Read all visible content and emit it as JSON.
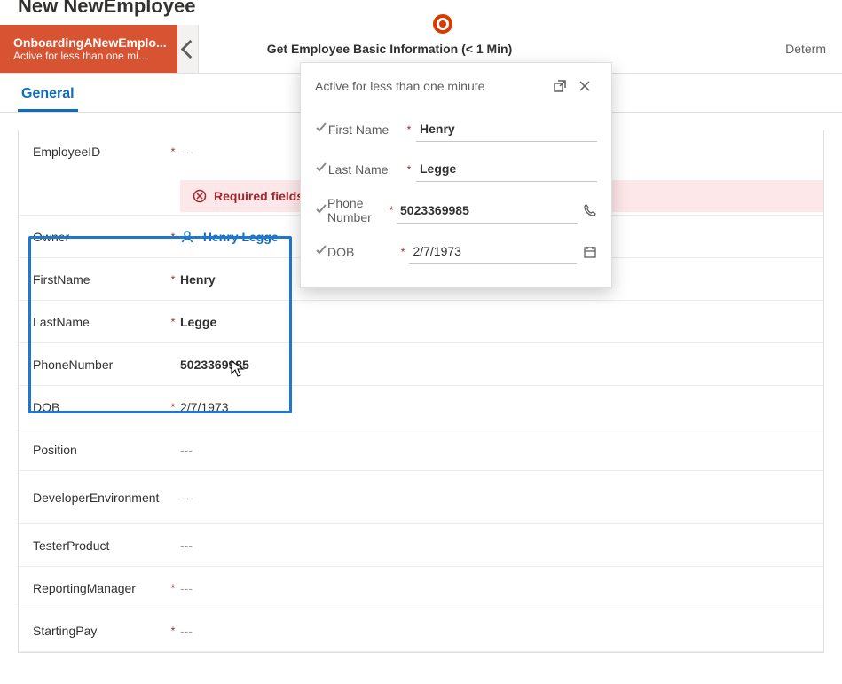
{
  "header": {
    "title": "New NewEmployee"
  },
  "bpf": {
    "active": {
      "name": "OnboardingANewEmplo...",
      "sub": "Active for less than one mi..."
    },
    "current": "Get Employee Basic Information  (< 1 Min)",
    "next": "Determ"
  },
  "tabs": {
    "general": "General"
  },
  "form": {
    "employeeId": {
      "label": "EmployeeID",
      "value": "---"
    },
    "errorBanner": "Required fields",
    "owner": {
      "label": "Owner",
      "value": "Henry Legge"
    },
    "firstName": {
      "label": "FirstName",
      "value": "Henry"
    },
    "lastName": {
      "label": "LastName",
      "value": "Legge"
    },
    "phone": {
      "label": "PhoneNumber",
      "value": "5023369985"
    },
    "dob": {
      "label": "DOB",
      "value": "2/7/1973"
    },
    "position": {
      "label": "Position",
      "value": "---"
    },
    "devEnv": {
      "label": "DeveloperEnvironment",
      "value": "---"
    },
    "testerProduct": {
      "label": "TesterProduct",
      "value": "---"
    },
    "reportingManager": {
      "label": "ReportingManager",
      "value": "---"
    },
    "startingPay": {
      "label": "StartingPay",
      "value": "---"
    }
  },
  "flyout": {
    "title": "Active for less than one minute",
    "firstName": {
      "label": "First Name",
      "value": "Henry"
    },
    "lastName": {
      "label": "Last Name",
      "value": "Legge"
    },
    "phone": {
      "label": "Phone Number",
      "value": "5023369985"
    },
    "dob": {
      "label": "DOB",
      "value": "2/7/1973"
    }
  }
}
